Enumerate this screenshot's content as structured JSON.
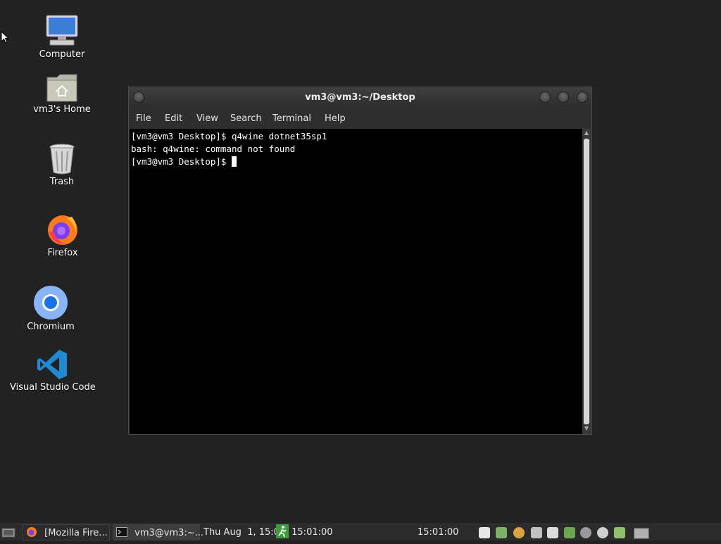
{
  "desktop": {
    "icons": [
      {
        "label": "Computer",
        "icon": "computer-icon"
      },
      {
        "label": "vm3's Home",
        "icon": "home-folder-icon"
      },
      {
        "label": "Trash",
        "icon": "trash-icon"
      },
      {
        "label": "Firefox",
        "icon": "firefox-icon"
      },
      {
        "label": "Chromium",
        "icon": "chromium-icon"
      },
      {
        "label": "Visual Studio Code",
        "icon": "vscode-icon"
      }
    ]
  },
  "terminal": {
    "title": "vm3@vm3:~/Desktop",
    "menu": [
      "File",
      "Edit",
      "View",
      "Search",
      "Terminal",
      "Help"
    ],
    "lines": [
      "[vm3@vm3 Desktop]$ q4wine dotnet35sp1",
      "bash: q4wine: command not found",
      "[vm3@vm3 Desktop]$ "
    ]
  },
  "taskbar": {
    "tasks": [
      "[Mozilla Fire...",
      "vm3@vm3:~..."
    ],
    "clock_date": "Thu Aug  1, 15:01",
    "runner_time": "15:01:00",
    "clock_time": "15:01:00"
  },
  "colors": {
    "desktop_bg": "#222222",
    "terminal_bg": "#000000",
    "terminal_fg": "#ffffff",
    "taskbar_bg": "#2b2b2b"
  }
}
